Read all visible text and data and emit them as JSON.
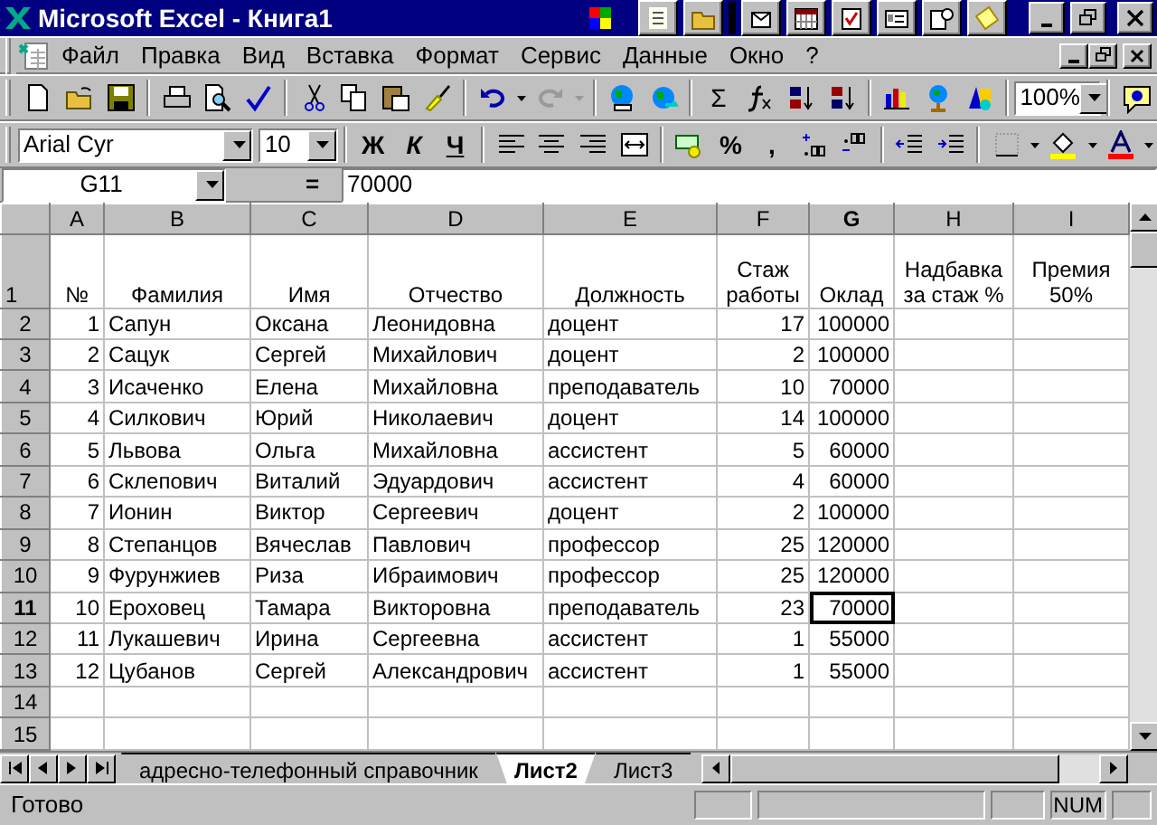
{
  "window": {
    "title": "Microsoft Excel - Книга1"
  },
  "menu": [
    {
      "label": "Файл"
    },
    {
      "label": "Правка"
    },
    {
      "label": "Вид"
    },
    {
      "label": "Вставка"
    },
    {
      "label": "Формат"
    },
    {
      "label": "Сервис"
    },
    {
      "label": "Данные"
    },
    {
      "label": "Окно"
    },
    {
      "label": "?"
    }
  ],
  "standard_toolbar": {
    "sum_label": "Σ",
    "zoom": "100%"
  },
  "format_toolbar": {
    "font": "Arial Cyr",
    "size": "10",
    "bold_label": "Ж",
    "italic_label": "К",
    "underline_label": "Ч",
    "percent_label": "%",
    "comma_label": ","
  },
  "formula_bar": {
    "name_box": "G11",
    "equals": "=",
    "value": "70000"
  },
  "columns": [
    {
      "label": "A",
      "kind": "number",
      "selected": false
    },
    {
      "label": "B",
      "kind": "text",
      "selected": false
    },
    {
      "label": "C",
      "kind": "text",
      "selected": false
    },
    {
      "label": "D",
      "kind": "text",
      "selected": false
    },
    {
      "label": "E",
      "kind": "text",
      "selected": false
    },
    {
      "label": "F",
      "kind": "number",
      "selected": false
    },
    {
      "label": "G",
      "kind": "number",
      "selected": true
    },
    {
      "label": "H",
      "kind": "number",
      "selected": false
    },
    {
      "label": "I",
      "kind": "number",
      "selected": false
    }
  ],
  "rows": [
    {
      "label": "1",
      "kind": "header",
      "selected": false,
      "cells": [
        "№",
        "Фамилия",
        "Имя",
        "Отчество",
        "Должность",
        "Стаж работы",
        "Оклад",
        "Надбавка за стаж %",
        "Премия 50%"
      ]
    },
    {
      "label": "2",
      "kind": "data",
      "selected": false,
      "cells": [
        "1",
        "Сапун",
        "Оксана",
        "Леонидовна",
        "доцент",
        "17",
        "100000",
        "",
        ""
      ]
    },
    {
      "label": "3",
      "kind": "data",
      "selected": false,
      "cells": [
        "2",
        "Сацук",
        "Сергей",
        "Михайлович",
        "доцент",
        "2",
        "100000",
        "",
        ""
      ]
    },
    {
      "label": "4",
      "kind": "data",
      "selected": false,
      "cells": [
        "3",
        "Исаченко",
        "Елена",
        "Михайловна",
        "преподаватель",
        "10",
        "70000",
        "",
        ""
      ]
    },
    {
      "label": "5",
      "kind": "data",
      "selected": false,
      "cells": [
        "4",
        "Силкович",
        "Юрий",
        "Николаевич",
        "доцент",
        "14",
        "100000",
        "",
        ""
      ]
    },
    {
      "label": "6",
      "kind": "data",
      "selected": false,
      "cells": [
        "5",
        "Львова",
        "Ольга",
        "Михайловна",
        "ассистент",
        "5",
        "60000",
        "",
        ""
      ]
    },
    {
      "label": "7",
      "kind": "data",
      "selected": false,
      "cells": [
        "6",
        "Склепович",
        "Виталий",
        "Эдуардович",
        "ассистент",
        "4",
        "60000",
        "",
        ""
      ]
    },
    {
      "label": "8",
      "kind": "data",
      "selected": false,
      "cells": [
        "7",
        "Ионин",
        "Виктор",
        "Сергеевич",
        "доцент",
        "2",
        "100000",
        "",
        ""
      ]
    },
    {
      "label": "9",
      "kind": "data",
      "selected": false,
      "cells": [
        "8",
        "Степанцов",
        "Вячеслав",
        "Павлович",
        "профессор",
        "25",
        "120000",
        "",
        ""
      ]
    },
    {
      "label": "10",
      "kind": "data",
      "selected": false,
      "cells": [
        "9",
        "Фурунжиев",
        "Риза",
        "Ибраимович",
        "профессор",
        "25",
        "120000",
        "",
        ""
      ]
    },
    {
      "label": "11",
      "kind": "data",
      "selected": true,
      "cells": [
        "10",
        "Ероховец",
        "Тамара",
        "Викторовна",
        "преподаватель",
        "23",
        "70000",
        "",
        ""
      ]
    },
    {
      "label": "12",
      "kind": "data",
      "selected": false,
      "cells": [
        "11",
        "Лукашевич",
        "Ирина",
        "Сергеевна",
        "ассистент",
        "1",
        "55000",
        "",
        ""
      ]
    },
    {
      "label": "13",
      "kind": "data",
      "selected": false,
      "cells": [
        "12",
        "Цубанов",
        "Сергей",
        "Александрович",
        "ассистент",
        "1",
        "55000",
        "",
        ""
      ]
    },
    {
      "label": "14",
      "kind": "data",
      "selected": false,
      "cells": [
        "",
        "",
        "",
        "",
        "",
        "",
        "",
        "",
        ""
      ]
    },
    {
      "label": "15",
      "kind": "data",
      "selected": false,
      "cells": [
        "",
        "",
        "",
        "",
        "",
        "",
        "",
        "",
        ""
      ]
    }
  ],
  "sheet_tabs": [
    {
      "label": "адресно-телефонный справочник",
      "selected": false
    },
    {
      "label": "Лист2",
      "selected": true
    },
    {
      "label": "Лист3",
      "selected": false
    }
  ],
  "status_bar": {
    "text": "Готово",
    "num": "NUM"
  }
}
